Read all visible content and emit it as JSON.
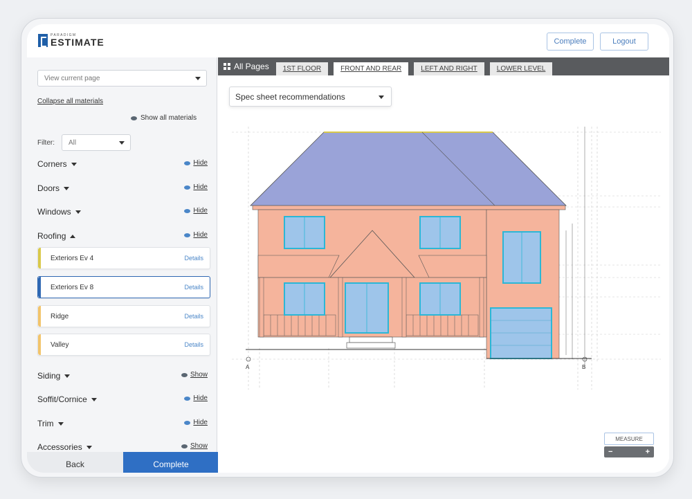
{
  "app": {
    "logo_small": "PARADIGM",
    "logo_big": "ESTIMATE",
    "complete_label": "Complete",
    "logout_label": "Logout"
  },
  "sidebar": {
    "view_select": "View current page",
    "collapse_link": "Collapse all materials",
    "show_all": "Show all materials",
    "filter_label": "Filter:",
    "filter_value": "All",
    "categories": [
      {
        "name": "Corners",
        "toggle": "Hide"
      },
      {
        "name": "Doors",
        "toggle": "Hide"
      },
      {
        "name": "Windows",
        "toggle": "Hide"
      },
      {
        "name": "Roofing",
        "toggle": "Hide"
      },
      {
        "name": "Siding",
        "toggle": "Show"
      },
      {
        "name": "Soffit/Cornice",
        "toggle": "Hide"
      },
      {
        "name": "Trim",
        "toggle": "Hide"
      },
      {
        "name": "Accessories",
        "toggle": "Show"
      }
    ],
    "materials": [
      {
        "name": "Exteriors Ev 4",
        "details": "Details",
        "color": "#d9c94a"
      },
      {
        "name": "Exteriors Ev 8",
        "details": "Details",
        "color": "#2f68b3"
      },
      {
        "name": "Ridge",
        "details": "Details",
        "color": "#f2c46b"
      },
      {
        "name": "Valley",
        "details": "Details",
        "color": "#f2c46b"
      }
    ],
    "back_label": "Back",
    "complete_label": "Complete"
  },
  "main": {
    "all_pages": "All Pages",
    "tabs": [
      "1ST FLOOR",
      "FRONT AND REAR",
      "LEFT AND RIGHT",
      "LOWER LEVEL"
    ],
    "active_tab": "FRONT AND REAR",
    "spec_select": "Spec sheet recommendations",
    "measure_label": "MEASURE",
    "zoom_out": "−",
    "zoom_in": "+",
    "drawing_marks": {
      "left_marker": "A",
      "right_marker": "B"
    }
  },
  "colors": {
    "accent": "#2f6fc4",
    "roof": "#9aa3d8",
    "walls": "#f5b49c",
    "windows": "#9ec5ea",
    "window_frame": "#2bb7d6"
  }
}
